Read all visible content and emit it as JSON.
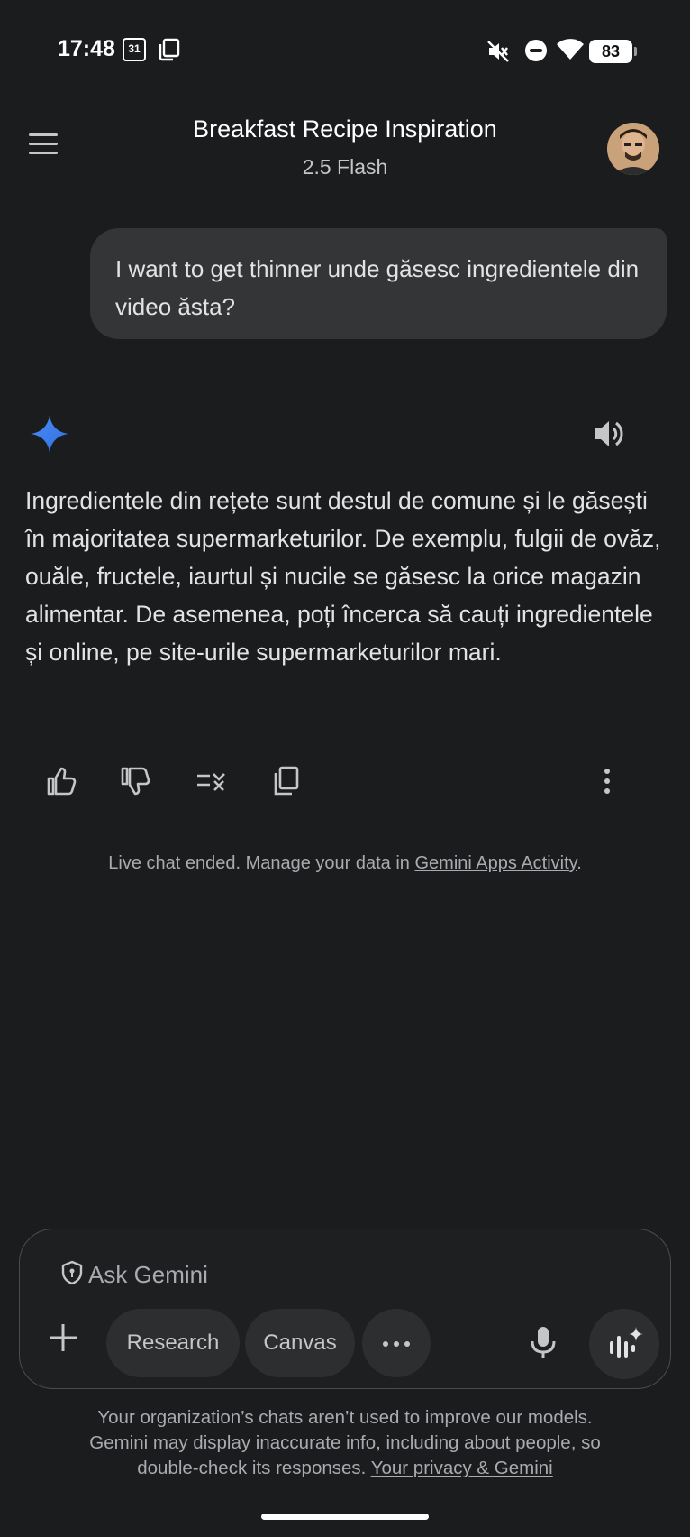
{
  "status_bar": {
    "time": "17:48",
    "calendar_day": "31",
    "battery": "83",
    "icons": [
      "calendar-icon",
      "screenshot-icon",
      "mute-icon",
      "do-not-disturb-icon",
      "wifi-icon",
      "battery-icon"
    ]
  },
  "header": {
    "title": "Breakfast Recipe Inspiration",
    "model": "2.5 Flash",
    "menu_icon": "hamburger-menu-icon",
    "avatar_icon": "user-avatar"
  },
  "conversation": {
    "user_message": "I want to get thinner unde găsesc ingredientele din video ăsta?",
    "response_text": "Ingredientele din rețete sunt destul de comune și le găsești în majoritatea supermarketurilor. De exemplu, fulgii de ovăz, ouăle, fructele, iaurtul și nucile se găsesc la orice magazin alimentar. De asemenea, poți încerca să cauți ingredientele și online, pe site-urile supermarketurilor mari.",
    "actions": [
      "thumbs-up-icon",
      "thumbs-down-icon",
      "modify-response-icon",
      "copy-icon",
      "more-options-icon"
    ]
  },
  "notice": {
    "text": "Live chat ended. Manage your data in ",
    "link": "Gemini Apps Activity",
    "suffix": "."
  },
  "input": {
    "placeholder": "Ask Gemini",
    "chips": {
      "research": "Research",
      "canvas": "Canvas"
    }
  },
  "disclaimer": {
    "line1": "Your organization’s chats aren’t used to improve our models.",
    "line2": "Gemini may display inaccurate info, including about people, so",
    "line3_prefix": "double-check its responses. ",
    "link": "Your privacy & Gemini"
  },
  "colors": {
    "background": "#1b1c1d",
    "bubble": "#333537",
    "accent": "#4b8df8"
  }
}
